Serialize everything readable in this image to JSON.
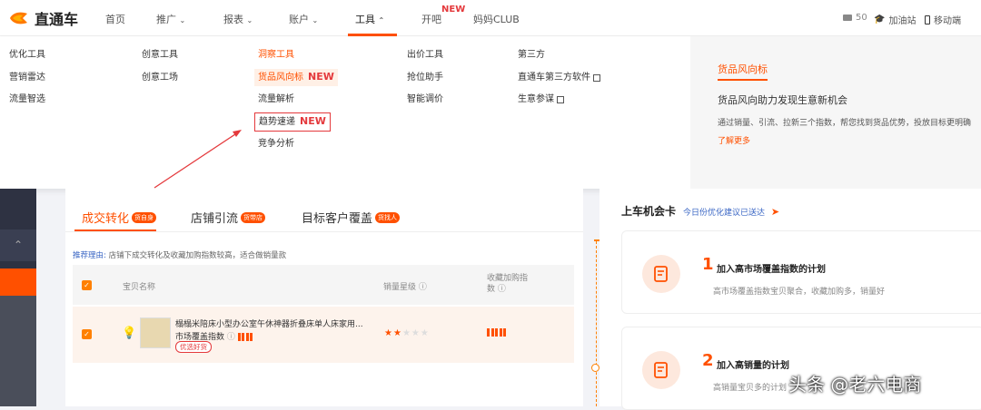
{
  "header": {
    "logo_text": "直通车",
    "nav": [
      {
        "label": "首页"
      },
      {
        "label": "推广"
      },
      {
        "label": "报表"
      },
      {
        "label": "账户"
      },
      {
        "label": "工具"
      },
      {
        "label": "开吧"
      },
      {
        "label": "妈妈CLUB"
      }
    ],
    "new_badge": "NEW",
    "right": {
      "count": "50",
      "site_label": "加油站",
      "mobile_label": "移动端"
    }
  },
  "dropdown": {
    "col1": [
      "优化工具",
      "营销雷达",
      "流量智选"
    ],
    "col2": [
      "创意工具",
      "创意工场"
    ],
    "col3": [
      "洞察工具",
      "货品风向标",
      "流量解析",
      "趋势速递",
      "竞争分析"
    ],
    "col4": [
      "出价工具",
      "抢位助手",
      "智能调价"
    ],
    "col5": [
      "第三方",
      "直通车第三方软件",
      "生意参谋"
    ],
    "new_label": "NEW",
    "desc": {
      "title": "货品风向标",
      "subtitle": "货品风向助力发现生意新机会",
      "body": "通过销量、引流、拉新三个指数，帮您找到货品优势，投放目标更明确",
      "more": "了解更多"
    }
  },
  "left_panel": {
    "tabs": [
      {
        "label": "成交转化",
        "badge": "货自身"
      },
      {
        "label": "店铺引流",
        "badge": "货带店"
      },
      {
        "label": "目标客户覆盖",
        "badge": "货找人"
      }
    ],
    "reason_label": "推荐理由:",
    "reason_text": "店铺下成交转化及收藏加购指数较高，适合做销量款",
    "table": {
      "col_name": "宝贝名称",
      "col_sales": "销量星级",
      "col_fav": "收藏加购指数",
      "row": {
        "title": "榻榻米陪床小型办公室午休神器折叠床单人床家用...",
        "metric_label": "市场覆盖指数",
        "tag": "优选好货",
        "stars": 2,
        "stars_max": 5
      }
    }
  },
  "right_panel": {
    "title": "上车机会卡",
    "hint": "今日份优化建议已送达",
    "cards": [
      {
        "num": "1",
        "title": "加入高市场覆盖指数的计划",
        "desc": "高市场覆盖指数宝贝聚合，收藏加购多，销量好"
      },
      {
        "num": "2",
        "title": "加入高销量的计划",
        "desc": "高销量宝贝多的计划"
      }
    ]
  },
  "watermark": "头条 @老六电商",
  "colors": {
    "accent": "#ff5000",
    "highlight_red": "#e4393c",
    "sidebar": "#2e3242"
  }
}
